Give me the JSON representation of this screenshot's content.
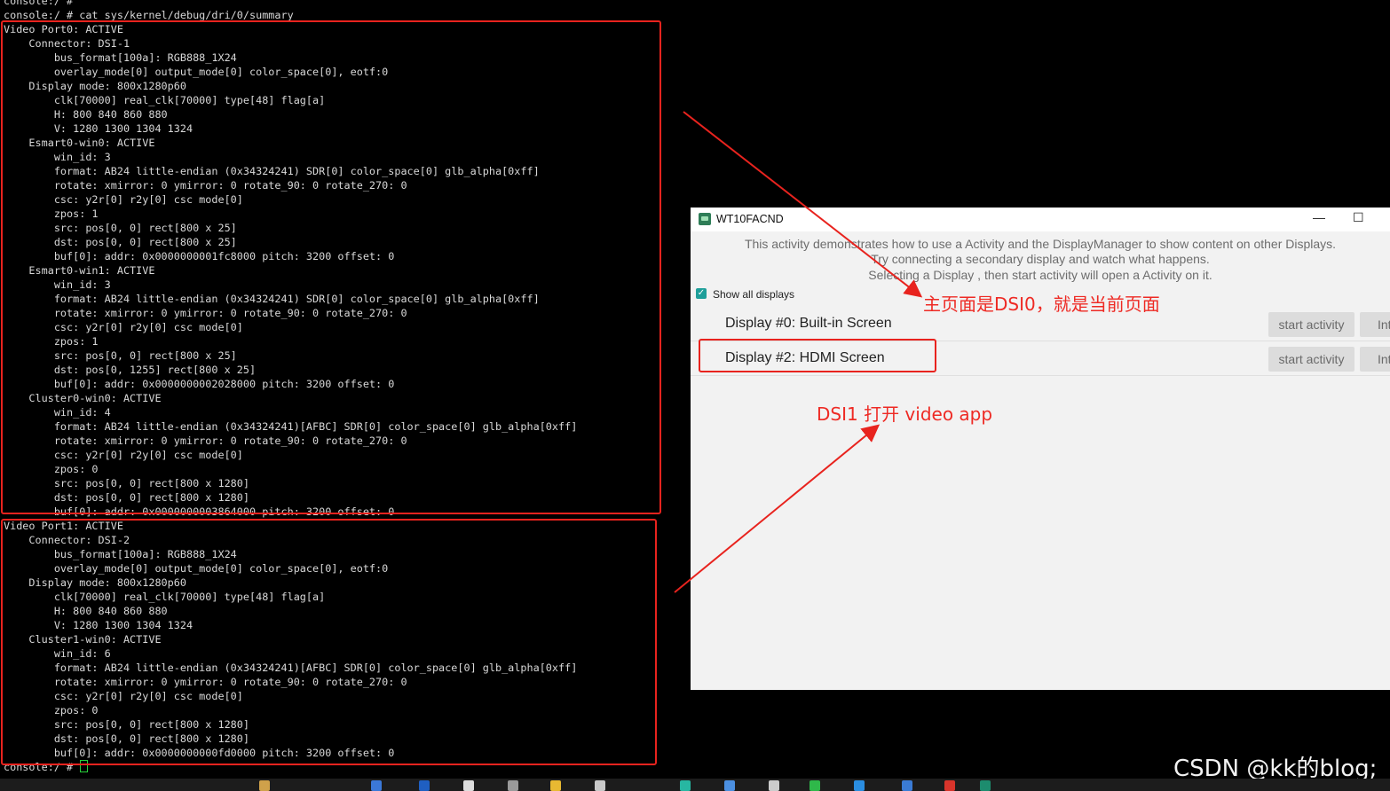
{
  "terminal": {
    "lines": [
      "console:/ #",
      "console:/ # cat sys/kernel/debug/dri/0/summary",
      "Video Port0: ACTIVE",
      "    Connector: DSI-1",
      "        bus_format[100a]: RGB888_1X24",
      "        overlay_mode[0] output_mode[0] color_space[0], eotf:0",
      "    Display mode: 800x1280p60",
      "        clk[70000] real_clk[70000] type[48] flag[a]",
      "        H: 800 840 860 880",
      "        V: 1280 1300 1304 1324",
      "    Esmart0-win0: ACTIVE",
      "        win_id: 3",
      "        format: AB24 little-endian (0x34324241) SDR[0] color_space[0] glb_alpha[0xff]",
      "        rotate: xmirror: 0 ymirror: 0 rotate_90: 0 rotate_270: 0",
      "        csc: y2r[0] r2y[0] csc mode[0]",
      "        zpos: 1",
      "        src: pos[0, 0] rect[800 x 25]",
      "        dst: pos[0, 0] rect[800 x 25]",
      "        buf[0]: addr: 0x0000000001fc8000 pitch: 3200 offset: 0",
      "    Esmart0-win1: ACTIVE",
      "        win_id: 3",
      "        format: AB24 little-endian (0x34324241) SDR[0] color_space[0] glb_alpha[0xff]",
      "        rotate: xmirror: 0 ymirror: 0 rotate_90: 0 rotate_270: 0",
      "        csc: y2r[0] r2y[0] csc mode[0]",
      "        zpos: 1",
      "        src: pos[0, 0] rect[800 x 25]",
      "        dst: pos[0, 1255] rect[800 x 25]",
      "        buf[0]: addr: 0x0000000002028000 pitch: 3200 offset: 0",
      "    Cluster0-win0: ACTIVE",
      "        win_id: 4",
      "        format: AB24 little-endian (0x34324241)[AFBC] SDR[0] color_space[0] glb_alpha[0xff]",
      "        rotate: xmirror: 0 ymirror: 0 rotate_90: 0 rotate_270: 0",
      "        csc: y2r[0] r2y[0] csc mode[0]",
      "        zpos: 0",
      "        src: pos[0, 0] rect[800 x 1280]",
      "        dst: pos[0, 0] rect[800 x 1280]",
      "        buf[0]: addr: 0x0000000003864000 pitch: 3200 offset: 0",
      "Video Port1: ACTIVE",
      "    Connector: DSI-2",
      "        bus_format[100a]: RGB888_1X24",
      "        overlay_mode[0] output_mode[0] color_space[0], eotf:0",
      "    Display mode: 800x1280p60",
      "        clk[70000] real_clk[70000] type[48] flag[a]",
      "        H: 800 840 860 880",
      "        V: 1280 1300 1304 1324",
      "    Cluster1-win0: ACTIVE",
      "        win_id: 6",
      "        format: AB24 little-endian (0x34324241)[AFBC] SDR[0] color_space[0] glb_alpha[0xff]",
      "        rotate: xmirror: 0 ymirror: 0 rotate_90: 0 rotate_270: 0",
      "        csc: y2r[0] r2y[0] csc mode[0]",
      "        zpos: 0",
      "        src: pos[0, 0] rect[800 x 1280]",
      "        dst: pos[0, 0] rect[800 x 1280]",
      "        buf[0]: addr: 0x0000000000fd0000 pitch: 3200 offset: 0",
      "console:/ # "
    ]
  },
  "app": {
    "title": "WT10FACND",
    "minimize_glyph": "—",
    "maximize_glyph": "☐",
    "description": [
      "This activity demonstrates how to use a Activity and the DisplayManager to show content on other Displays.",
      "Try connecting a secondary display and watch what happens.",
      "Selecting a Display , then start activity will open a Activity on it."
    ],
    "show_all_displays": {
      "label": "Show all displays",
      "checked": true
    },
    "displays": [
      {
        "label": "Display #0: Built-in Screen",
        "start_label": "start activity",
        "info_label": "Int"
      },
      {
        "label": "Display #2: HDMI Screen",
        "start_label": "start activity",
        "info_label": "Int"
      }
    ]
  },
  "annotations": {
    "main_page": "主页面是DSI0，就是当前页面",
    "dsi1_video": "DSI1 打开 video app"
  },
  "watermark": "CSDN @kk的blog;",
  "colors": {
    "annotation_red": "#e8231e",
    "checkbox_teal": "#1f9f9a",
    "terminal_bg": "#000000"
  }
}
